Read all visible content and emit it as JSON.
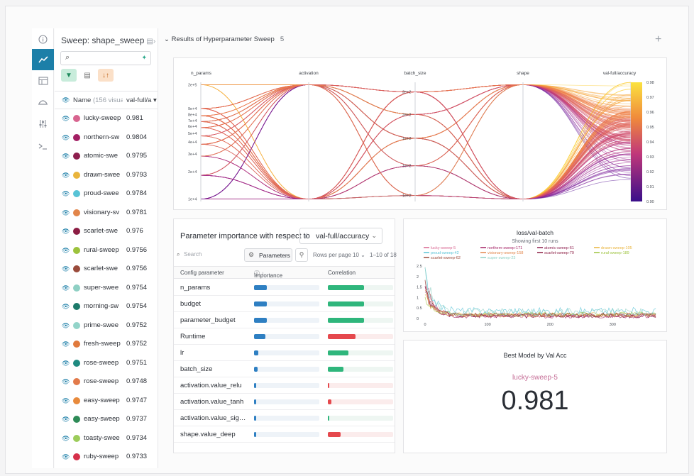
{
  "sidebar": {
    "icons": [
      "info-icon",
      "chart-icon",
      "table-icon",
      "sweep-icon",
      "sliders-icon",
      "terminal-icon"
    ]
  },
  "runs_panel": {
    "sweep_title": "Sweep: shape_sweep",
    "header_name": "Name",
    "header_visual": "(156 visual",
    "header_value": "val-full/a",
    "runs": [
      {
        "name": "lucky-sweep",
        "value": "0.981",
        "color": "#d8648f"
      },
      {
        "name": "northern-sw",
        "value": "0.9804",
        "color": "#a31f63"
      },
      {
        "name": "atomic-swe",
        "value": "0.9795",
        "color": "#8e1f4e"
      },
      {
        "name": "drawn-swee",
        "value": "0.9793",
        "color": "#e9b43c"
      },
      {
        "name": "proud-swee",
        "value": "0.9784",
        "color": "#58c3d6"
      },
      {
        "name": "visionary-sv",
        "value": "0.9781",
        "color": "#e2854a"
      },
      {
        "name": "scarlet-swe",
        "value": "0.976",
        "color": "#8c1d43"
      },
      {
        "name": "rural-sweep",
        "value": "0.9756",
        "color": "#9cc23c"
      },
      {
        "name": "scarlet-swe",
        "value": "0.9756",
        "color": "#9a4b3b"
      },
      {
        "name": "super-swee",
        "value": "0.9754",
        "color": "#8fd0c4"
      },
      {
        "name": "morning-sw",
        "value": "0.9754",
        "color": "#1c7a6a"
      },
      {
        "name": "prime-swee",
        "value": "0.9752",
        "color": "#93d4c9"
      },
      {
        "name": "fresh-sweep",
        "value": "0.9752",
        "color": "#e07a3d"
      },
      {
        "name": "rose-sweep",
        "value": "0.9751",
        "color": "#1f8a80"
      },
      {
        "name": "rose-sweep",
        "value": "0.9748",
        "color": "#e27a4a"
      },
      {
        "name": "easy-sweep",
        "value": "0.9747",
        "color": "#e88a3c"
      },
      {
        "name": "easy-sweep",
        "value": "0.9737",
        "color": "#2e8b57"
      },
      {
        "name": "toasty-swee",
        "value": "0.9734",
        "color": "#9ccc5a"
      },
      {
        "name": "ruby-sweep",
        "value": "0.9733",
        "color": "#d6304a"
      }
    ]
  },
  "section": {
    "title": "Results of Hyperparameter Sweep",
    "count": "5"
  },
  "parallel_coords": {
    "axes": [
      {
        "label": "n_params",
        "ticks": [
          "2e+5",
          "9e+4",
          "8e+4",
          "7e+4",
          "6e+4",
          "5e+4",
          "4e+4",
          "3e+4",
          "2e+4",
          "1e+4"
        ]
      },
      {
        "label": "activation",
        "ticks": []
      },
      {
        "label": "batch_size",
        "ticks": [
          "2e+2",
          "2e+2",
          "1e+2",
          "1e+2",
          "1e+2"
        ]
      },
      {
        "label": "shape",
        "ticks": []
      },
      {
        "label": "val-full/accuracy",
        "ticks": [
          "0.98",
          "0.97",
          "0.96",
          "0.95",
          "0.94",
          "0.93",
          "0.92",
          "0.91",
          "0.90"
        ]
      }
    ]
  },
  "importance": {
    "title": "Parameter importance with respect to",
    "metric": "val-full/accuracy",
    "search_placeholder": "Search",
    "parameters_label": "Parameters",
    "rows_per_page_label": "Rows per page",
    "rows_per_page": "10",
    "range": "1–10 of 18",
    "col_param": "Config parameter",
    "col_importance": "Importance",
    "col_correlation": "Correlation",
    "rows": [
      {
        "name": "n_params",
        "importance": 0.2,
        "correlation": 0.55
      },
      {
        "name": "budget",
        "importance": 0.2,
        "correlation": 0.55
      },
      {
        "name": "parameter_budget",
        "importance": 0.2,
        "correlation": 0.55
      },
      {
        "name": "Runtime",
        "importance": 0.17,
        "correlation": -0.42
      },
      {
        "name": "lr",
        "importance": 0.07,
        "correlation": 0.32
      },
      {
        "name": "batch_size",
        "importance": 0.05,
        "correlation": 0.24
      },
      {
        "name": "activation.value_relu",
        "importance": 0.02,
        "correlation": -0.01
      },
      {
        "name": "activation.value_tanh",
        "importance": 0.02,
        "correlation": -0.05
      },
      {
        "name": "activation.value_sig…",
        "importance": 0.02,
        "correlation": 0.02
      },
      {
        "name": "shape.value_deep",
        "importance": 0.02,
        "correlation": -0.2
      }
    ],
    "colors": {
      "importance": "#2e7fc2",
      "positive": "#2fb67c",
      "negative": "#e5484d"
    }
  },
  "loss_chart": {
    "title": "loss/val-batch",
    "subtitle": "Showing first 10 runs",
    "legend": [
      {
        "name": "lucky-sweep-5",
        "color": "#d8648f"
      },
      {
        "name": "northern-sweep-171",
        "color": "#a31f63"
      },
      {
        "name": "atomic-sweep-61",
        "color": "#8e1f4e"
      },
      {
        "name": "drawn-sweep-105",
        "color": "#e9b43c"
      },
      {
        "name": "proud-sweep-42",
        "color": "#58c3d6"
      },
      {
        "name": "visionary-sweep-158",
        "color": "#e2854a"
      },
      {
        "name": "scarlet-sweep-79",
        "color": "#8c1d43"
      },
      {
        "name": "rural-sweep-189",
        "color": "#9cc23c"
      },
      {
        "name": "scarlet-sweep-62",
        "color": "#9a4b3b"
      },
      {
        "name": "super-sweep-23",
        "color": "#8fd0c4"
      }
    ],
    "yticks": [
      "2.5",
      "2",
      "1.5",
      "1",
      "0.5",
      "0"
    ],
    "xticks": [
      "0",
      "100",
      "200",
      "300"
    ]
  },
  "chart_data": {
    "type": "line",
    "title": "loss/val-batch",
    "xlim": [
      0,
      370
    ],
    "ylim": [
      0,
      2.5
    ],
    "series": [
      {
        "name": "lucky-sweep-5",
        "start": 1.9,
        "end": 0.15
      },
      {
        "name": "northern-sweep-171",
        "start": 1.6,
        "end": 0.12
      },
      {
        "name": "atomic-sweep-61",
        "start": 1.4,
        "end": 0.14
      },
      {
        "name": "drawn-sweep-105",
        "start": 1.2,
        "end": 0.18
      },
      {
        "name": "proud-sweep-42",
        "start": 2.1,
        "end": 0.35
      },
      {
        "name": "visionary-sweep-158",
        "start": 1.3,
        "end": 0.16
      },
      {
        "name": "scarlet-sweep-79",
        "start": 1.5,
        "end": 0.13
      },
      {
        "name": "rural-sweep-189",
        "start": 1.1,
        "end": 0.2
      },
      {
        "name": "scarlet-sweep-62",
        "start": 1.7,
        "end": 0.17
      },
      {
        "name": "super-sweep-23",
        "start": 2.2,
        "end": 0.3
      }
    ]
  },
  "best_model": {
    "title": "Best Model by Val Acc",
    "run": "lucky-sweep-5",
    "value": "0.981"
  }
}
